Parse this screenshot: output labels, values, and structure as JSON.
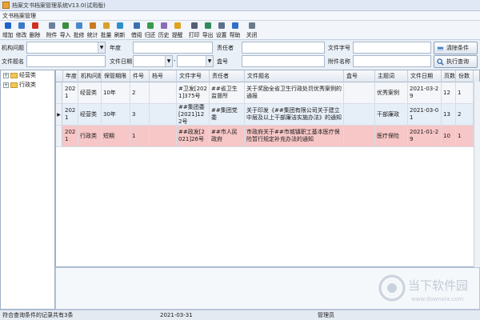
{
  "window": {
    "title": "档案文书档案管理系统V13.0(试用版)"
  },
  "module": {
    "label": "文书档案管理"
  },
  "toolbar": {
    "items": [
      {
        "label": "增加",
        "icon": "add-icon",
        "color": "#1e63c8"
      },
      {
        "label": "修改",
        "icon": "edit-icon",
        "color": "#3c78c8"
      },
      {
        "label": "删除",
        "icon": "delete-icon",
        "color": "#d03020"
      },
      {
        "label": "附件",
        "icon": "paperclip-icon",
        "color": "#6a7fa0"
      },
      {
        "label": "导入",
        "icon": "import-icon",
        "color": "#3b8f3b"
      },
      {
        "label": "批修",
        "icon": "batch-edit-icon",
        "color": "#4a88cc"
      },
      {
        "label": "统计",
        "icon": "stats-icon",
        "color": "#c87a20"
      },
      {
        "label": "批量",
        "icon": "batch-icon",
        "color": "#d8a030"
      },
      {
        "label": "刷新",
        "icon": "refresh-icon",
        "color": "#2d8fd0"
      },
      {
        "label": "借阅",
        "icon": "borrow-icon",
        "color": "#3a6fb0"
      },
      {
        "label": "归还",
        "icon": "return-icon",
        "color": "#3a9a4a"
      },
      {
        "label": "历史",
        "icon": "history-icon",
        "color": "#8a6cb8"
      },
      {
        "label": "提醒",
        "icon": "bell-icon",
        "color": "#e0a020"
      },
      {
        "label": "打印",
        "icon": "print-icon",
        "color": "#555f70"
      },
      {
        "label": "导出",
        "icon": "export-icon",
        "color": "#2f8a5a"
      },
      {
        "label": "设置",
        "icon": "gear-icon",
        "color": "#5a6f8a"
      },
      {
        "label": "帮助",
        "icon": "help-icon",
        "color": "#2f6fc8"
      },
      {
        "label": "关闭",
        "icon": "close-door-icon",
        "color": "#6a7a8a"
      }
    ]
  },
  "filters": {
    "org_label": "机构问题",
    "year_label": "年度",
    "responsible_label": "责任者",
    "docno_label": "文件字号",
    "filename_label": "文件题名",
    "filedate_label": "文件日期",
    "box_label": "盒号",
    "attachment_label": "附件名称",
    "date_separator": "-",
    "clear_button": "清除条件",
    "query_button": "执行查询"
  },
  "tree": {
    "nodes": [
      {
        "label": "经营类",
        "toggle": "+"
      },
      {
        "label": "行政类",
        "toggle": "+"
      }
    ]
  },
  "table": {
    "headers": [
      "年度",
      "机构问题",
      "保管期限",
      "件号",
      "档号",
      "文件字号",
      "责任者",
      "文件题名",
      "盒号",
      "主题词",
      "文件日期",
      "页数",
      "份数"
    ],
    "rows": [
      {
        "cells": [
          "2021",
          "经营类",
          "10年",
          "2",
          "",
          "#卫发[2021]375号",
          "##省卫生监督所",
          "关于奖励全省卫生行政处罚优秀案例的通报",
          "",
          "优秀案例",
          "2021-03-29",
          "12",
          "1"
        ],
        "bg": "#f4f6f9"
      },
      {
        "cells": [
          "2021",
          "经营类",
          "30年",
          "3",
          "",
          "##集团委[2021]122号",
          "##集团党委",
          "关于印发《##集团有限公司关于建立中层及以上干部廉洁实施办法》的通知",
          "",
          "干部廉政",
          "2021-03-01",
          "13",
          "2"
        ],
        "bg": "#e6eef8"
      },
      {
        "cells": [
          "2021",
          "行政类",
          "短期",
          "1",
          "",
          "##政发[2021]26号",
          "##市人民政府",
          "市政府关于##市城镇职工基本医疗保险暂行规定补充办法的通知",
          "",
          "医疗保险",
          "2021-01-29",
          "10",
          "1"
        ],
        "bg": "#f7c6c6"
      }
    ],
    "current_row_marker": "▶"
  },
  "status": {
    "count_text": "符合查询条件的记录共有3条",
    "date": "2021-03-31",
    "user": "管理员"
  },
  "watermark": {
    "brand": "当下软件园",
    "site": "www.downxia.com"
  }
}
